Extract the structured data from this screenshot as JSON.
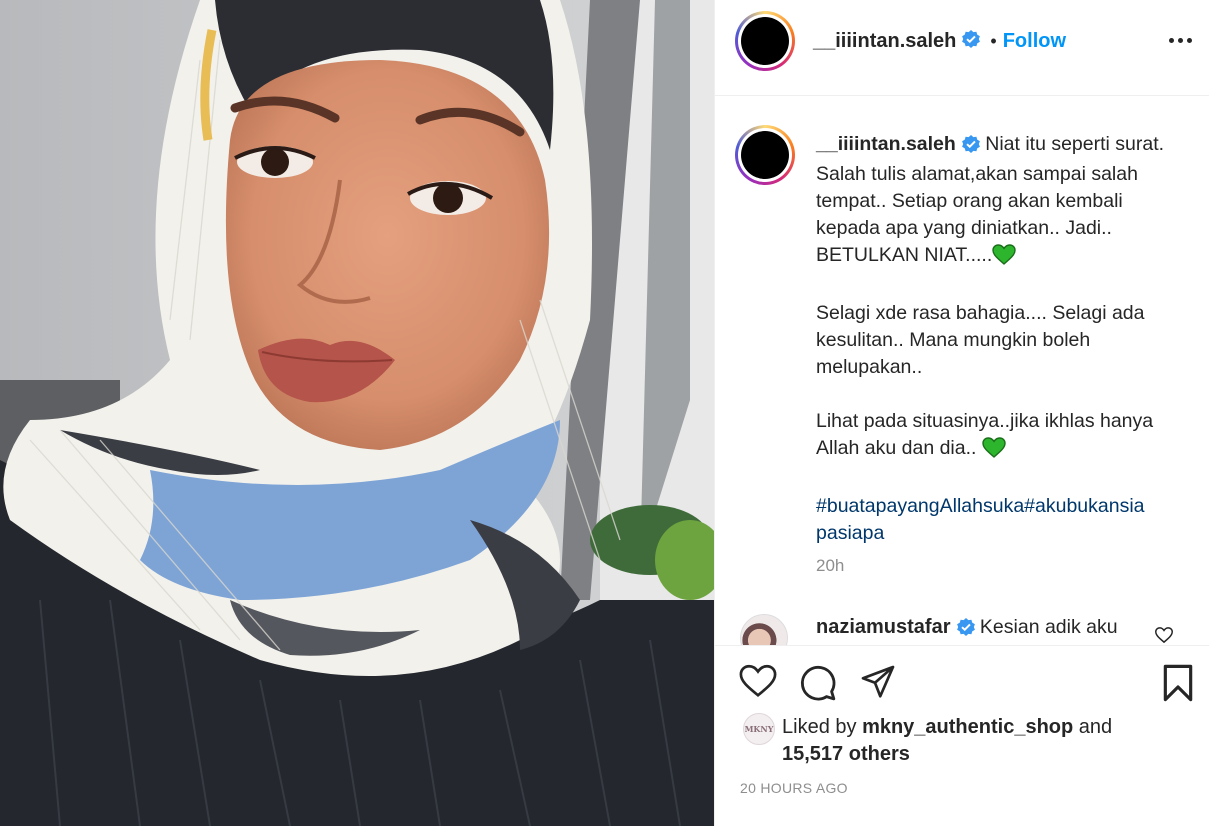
{
  "post": {
    "username": "__iiiintan.saleh",
    "verified": true,
    "separator": "•",
    "follow_label": "Follow",
    "more_icon": "more-options-icon"
  },
  "caption": {
    "username": "__iiiintan.saleh",
    "paragraph1": "Niat itu seperti surat. Salah tulis alamat,akan sampai salah tempat.. Setiap orang akan kembali kepada apa yang diniatkan.. Jadi.. BETULKAN NIAT.....",
    "paragraph2": "Selagi xde rasa bahagia.... Selagi ada kesulitan.. Mana mungkin boleh melupakan..",
    "paragraph3": "Lihat pada situasinya..jika ikhlas hanya Allah aku dan dia..",
    "hashtags": "#buatapayangAllahsuka#akubukansia pasiapa",
    "time": "20h",
    "heart_color": "#2db52d"
  },
  "comments": [
    {
      "username": "naziamustafar",
      "verified": true,
      "text": "Kesian adik aku"
    }
  ],
  "actions": {
    "like_icon": "heart-icon",
    "comment_icon": "comment-icon",
    "share_icon": "share-icon",
    "save_icon": "bookmark-icon"
  },
  "likes": {
    "avatar_text": "MKNY",
    "prefix": "Liked by",
    "user": "mkny_authentic_shop",
    "conj": "and",
    "count": "15,517 others"
  },
  "timestamp": "20 HOURS AGO",
  "colors": {
    "link": "#0095f6",
    "hashtag": "#00376b",
    "verified": "#3897f0",
    "muted": "#8e8e8e"
  }
}
